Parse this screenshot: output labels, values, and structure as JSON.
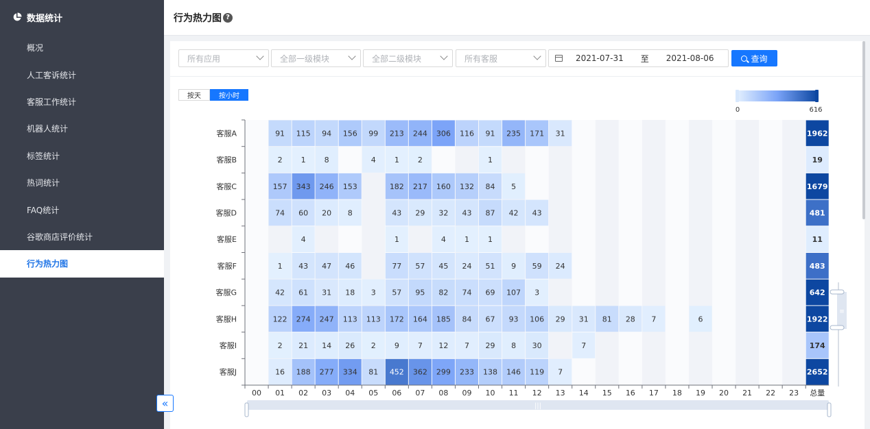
{
  "sidebar": {
    "header": "数据统计",
    "items": [
      {
        "label": "概况",
        "active": false
      },
      {
        "label": "人工客诉统计",
        "active": false
      },
      {
        "label": "客服工作统计",
        "active": false
      },
      {
        "label": "机器人统计",
        "active": false
      },
      {
        "label": "标签统计",
        "active": false
      },
      {
        "label": "热词统计",
        "active": false
      },
      {
        "label": "FAQ统计",
        "active": false
      },
      {
        "label": "谷歌商店评价统计",
        "active": false
      },
      {
        "label": "行为热力图",
        "active": true
      }
    ]
  },
  "page": {
    "title": "行为热力图",
    "help": "?"
  },
  "filters": {
    "app": "所有应用",
    "level1": "全部一级模块",
    "level2": "全部二级模块",
    "agent": "所有客服",
    "date_start": "2021-07-31",
    "date_sep": "至",
    "date_end": "2021-08-06",
    "query_label": "查询"
  },
  "toggle": {
    "by_day": "按天",
    "by_hour": "按小时",
    "selected": "by_hour"
  },
  "visual_map": {
    "min": 0,
    "max": 616,
    "min_label": "0",
    "max_label": "616"
  },
  "colors": {
    "accent": "#1677ff",
    "low": "#d3e7fd",
    "mid": "#6f9bf7",
    "high": "#0d47a1"
  },
  "chart_data": {
    "type": "heatmap",
    "x": [
      "00",
      "01",
      "02",
      "03",
      "04",
      "05",
      "06",
      "07",
      "08",
      "09",
      "10",
      "11",
      "12",
      "13",
      "14",
      "15",
      "16",
      "17",
      "18",
      "19",
      "20",
      "21",
      "22",
      "23",
      "总量"
    ],
    "y": [
      "客服A",
      "客服B",
      "客服C",
      "客服D",
      "客服E",
      "客服F",
      "客服G",
      "客服H",
      "客服I",
      "客服J"
    ],
    "values": [
      [
        null,
        91,
        115,
        94,
        156,
        99,
        213,
        244,
        306,
        116,
        91,
        235,
        171,
        31,
        null,
        null,
        null,
        null,
        null,
        null,
        null,
        null,
        null,
        null,
        1962
      ],
      [
        null,
        2,
        1,
        8,
        null,
        4,
        1,
        2,
        null,
        null,
        1,
        null,
        null,
        null,
        null,
        null,
        null,
        null,
        null,
        null,
        null,
        null,
        null,
        null,
        19
      ],
      [
        null,
        157,
        343,
        246,
        153,
        null,
        182,
        217,
        160,
        132,
        84,
        5,
        null,
        null,
        null,
        null,
        null,
        null,
        null,
        null,
        null,
        null,
        null,
        null,
        1679
      ],
      [
        null,
        74,
        60,
        20,
        8,
        null,
        43,
        29,
        32,
        43,
        87,
        42,
        43,
        null,
        null,
        null,
        null,
        null,
        null,
        null,
        null,
        null,
        null,
        null,
        481
      ],
      [
        null,
        null,
        4,
        null,
        null,
        null,
        1,
        null,
        4,
        1,
        1,
        null,
        null,
        null,
        null,
        null,
        null,
        null,
        null,
        null,
        null,
        null,
        null,
        null,
        11
      ],
      [
        null,
        1,
        43,
        47,
        46,
        null,
        77,
        57,
        45,
        24,
        51,
        9,
        59,
        24,
        null,
        null,
        null,
        null,
        null,
        null,
        null,
        null,
        null,
        null,
        483
      ],
      [
        null,
        42,
        61,
        31,
        18,
        3,
        57,
        95,
        82,
        74,
        69,
        107,
        3,
        null,
        null,
        null,
        null,
        null,
        null,
        null,
        null,
        null,
        null,
        null,
        642
      ],
      [
        null,
        122,
        274,
        247,
        113,
        113,
        172,
        164,
        185,
        84,
        67,
        93,
        106,
        29,
        31,
        81,
        28,
        7,
        null,
        6,
        null,
        null,
        null,
        null,
        1922
      ],
      [
        null,
        2,
        21,
        14,
        26,
        2,
        9,
        7,
        12,
        7,
        29,
        8,
        30,
        null,
        7,
        null,
        null,
        null,
        null,
        null,
        null,
        null,
        null,
        null,
        174
      ],
      [
        null,
        16,
        188,
        277,
        334,
        81,
        452,
        362,
        299,
        233,
        138,
        146,
        119,
        7,
        null,
        null,
        null,
        null,
        null,
        null,
        null,
        null,
        null,
        null,
        2652
      ]
    ]
  }
}
